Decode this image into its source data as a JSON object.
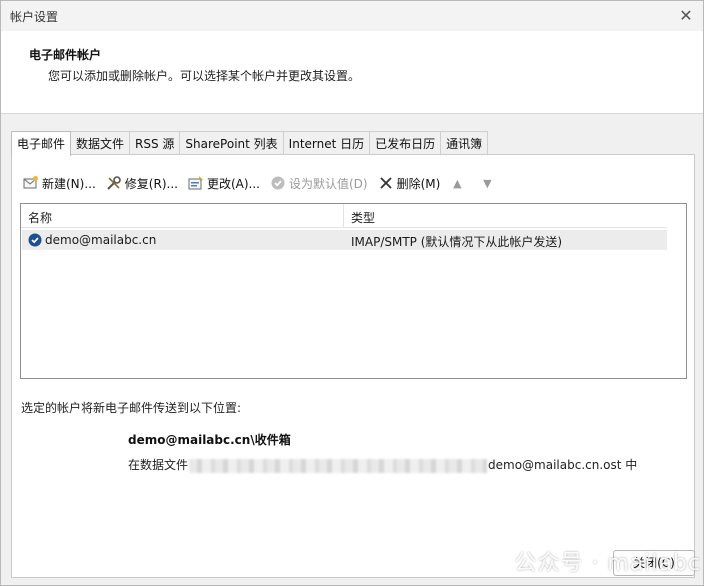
{
  "window": {
    "title": "帐户设置",
    "close_glyph": "✕"
  },
  "header": {
    "title": "电子邮件帐户",
    "description": "您可以添加或删除帐户。可以选择某个帐户并更改其设置。"
  },
  "tabs": [
    {
      "label": "电子邮件",
      "active": true
    },
    {
      "label": "数据文件"
    },
    {
      "label": "RSS 源"
    },
    {
      "label": "SharePoint 列表"
    },
    {
      "label": "Internet 日历"
    },
    {
      "label": "已发布日历"
    },
    {
      "label": "通讯簿"
    }
  ],
  "toolbar": {
    "new_label": "新建(N)...",
    "repair_label": "修复(R)...",
    "change_label": "更改(A)...",
    "set_default_label": "设为默认值(D)",
    "remove_label": "删除(M)",
    "icons": [
      "new-account-icon",
      "repair-icon",
      "change-icon",
      "set-default-icon",
      "remove-icon",
      "move-up-icon",
      "move-down-icon"
    ]
  },
  "accounts_table": {
    "columns": [
      "名称",
      "类型"
    ],
    "rows": [
      {
        "name": "demo@mailabc.cn",
        "type": "IMAP/SMTP (默认情况下从此帐户发送)",
        "default": true
      }
    ]
  },
  "delivery": {
    "label": "选定的帐户将新电子邮件传送到以下位置:",
    "folder": "demo@mailabc.cn\\收件箱",
    "path_prefix": "在数据文件",
    "path_suffix": "demo@mailabc.cn.ost 中"
  },
  "buttons": {
    "close_label": "关闭(C)"
  },
  "watermark": "公众号 · mailabc",
  "colors": {
    "panel_bg": "#ffffff",
    "dialog_bg": "#f0f0f0",
    "selected_row": "#ececec",
    "check_blue": "#1e4f8f"
  }
}
